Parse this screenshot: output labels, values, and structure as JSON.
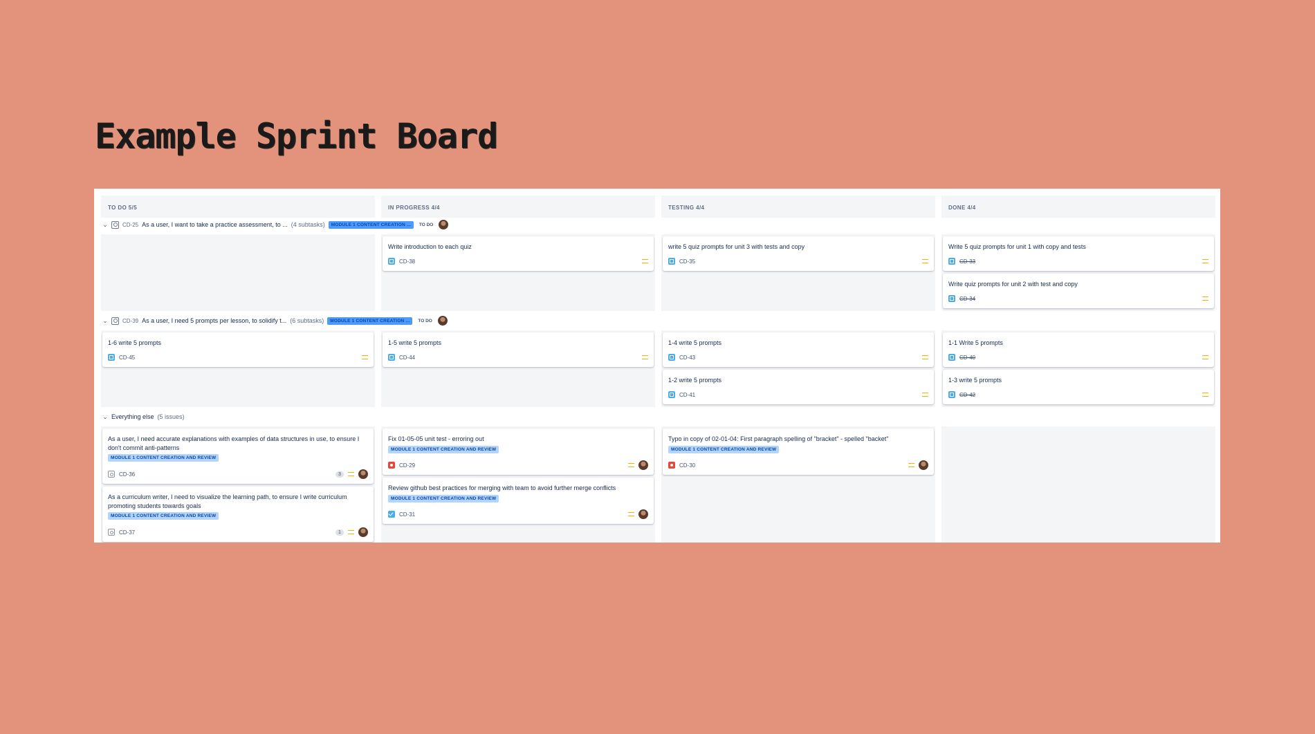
{
  "slide_title": "Example Sprint Board",
  "columns": [
    {
      "header": "TO DO 5/5"
    },
    {
      "header": "IN PROGRESS 4/4"
    },
    {
      "header": "TESTING 4/4"
    },
    {
      "header": "DONE 4/4"
    }
  ],
  "lanes": [
    {
      "key": "CD-25",
      "summary": "As a user, I want to take a practice assessment, to ...",
      "subtasks": "(4 subtasks)",
      "epic": "MODULE 1 CONTENT CREATION ...",
      "status": "TO DO"
    },
    {
      "key": "CD-39",
      "summary": "As a user, I need 5 prompts per lesson, to solidify t...",
      "subtasks": "(6 subtasks)",
      "epic": "MODULE 1 CONTENT CREATION ...",
      "status": "TO DO"
    },
    {
      "summary": "Everything else",
      "count": "(5 issues)"
    }
  ],
  "cards": {
    "cd38": {
      "summary": "Write introduction to each quiz",
      "key": "CD-38"
    },
    "cd35": {
      "summary": "write 5 quiz prompts for unit 3 with tests and copy",
      "key": "CD-35"
    },
    "cd33": {
      "summary": "Write 5 quiz prompts for unit 1 with copy and tests",
      "key": "CD-33"
    },
    "cd34": {
      "summary": "Write quiz prompts for unit 2 with test and copy",
      "key": "CD-34"
    },
    "cd45": {
      "summary": "1-6 write 5 prompts",
      "key": "CD-45"
    },
    "cd44": {
      "summary": "1-5 write 5 prompts",
      "key": "CD-44"
    },
    "cd43": {
      "summary": "1-4 write 5 prompts",
      "key": "CD-43"
    },
    "cd41": {
      "summary": "1-2 write 5 prompts",
      "key": "CD-41"
    },
    "cd40": {
      "summary": "1-1 Write 5 prompts",
      "key": "CD-40"
    },
    "cd42": {
      "summary": "1-3 write 5 prompts",
      "key": "CD-42"
    },
    "cd36": {
      "summary": "As a user, I need accurate explanations with examples of data structures in use, to ensure I don't commit anti-patterns",
      "epic": "MODULE 1 CONTENT CREATION AND REVIEW",
      "key": "CD-36",
      "estimate": "3"
    },
    "cd37": {
      "summary": "As a curriculum writer, I need to visualize the learning path, to ensure I write curriculum promoting students towards goals",
      "epic": "MODULE 1 CONTENT CREATION AND REVIEW",
      "key": "CD-37",
      "estimate": "1"
    },
    "cd29": {
      "summary": "Fix 01-05-05 unit test - erroring out",
      "epic": "MODULE 1 CONTENT CREATION AND REVIEW",
      "key": "CD-29"
    },
    "cd31": {
      "summary": "Review github best practices for merging with team to avoid further merge conflicts",
      "epic": "MODULE 1 CONTENT CREATION AND REVIEW",
      "key": "CD-31"
    },
    "cd30": {
      "summary": "Typo in copy of 02-01-04: First paragraph spelling of \"bracket\" - spelled \"backet\"",
      "epic": "MODULE 1 CONTENT CREATION AND REVIEW",
      "key": "CD-30"
    }
  },
  "icons": {
    "collapse": "chevron-down-icon",
    "story": "story-icon",
    "subtask": "subtask-icon",
    "bug": "bug-icon",
    "task": "task-icon",
    "priority": "priority-medium-icon",
    "avatar": "avatar"
  },
  "colors": {
    "slide_background": "#E3937B",
    "column_background": "#F4F5F7",
    "epic_lozenge": "#4C9AFF",
    "priority_medium": "#FFAB00",
    "bug": "#E5493A",
    "subtask": "#4BADE8"
  }
}
